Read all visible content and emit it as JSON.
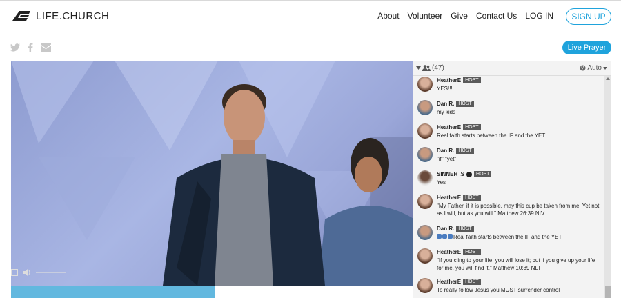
{
  "header": {
    "logo_text": "LIFE.CHURCH",
    "nav": [
      "About",
      "Volunteer",
      "Give",
      "Contact Us",
      "LOG IN"
    ],
    "signup_label": "SIGN UP"
  },
  "share_icons": [
    "twitter-icon",
    "facebook-icon",
    "email-icon"
  ],
  "live_prayer_label": "Live Prayer",
  "chat": {
    "viewer_count": "(47)",
    "quality": "Auto",
    "messages": [
      {
        "name": "HeatherE",
        "badge": "HOST",
        "text": "YES!!!"
      },
      {
        "name": "Dan R.",
        "badge": "HOST",
        "text": "my kids"
      },
      {
        "name": "HeatherE",
        "badge": "HOST",
        "text": "Real faith starts between the IF and the YET."
      },
      {
        "name": "Dan R.",
        "badge": "HOST",
        "text": "\"if\" \"yet\""
      },
      {
        "name": "SINNEH .S",
        "badge": "HOST",
        "text": "Yes"
      },
      {
        "name": "HeatherE",
        "badge": "HOST",
        "text": "\"My Father, if it is possible, may this cup be taken from me. Yet not as I will, but as you will.\" Matthew 26:39 NIV"
      },
      {
        "name": "Dan R.",
        "badge": "HOST",
        "text": "Real faith starts between the IF and the YET."
      },
      {
        "name": "HeatherE",
        "badge": "HOST",
        "text": "\"If you cling to your life, you will lose it; but if you give up your life for me, you will find it.\" Matthew 10:39 NLT"
      },
      {
        "name": "HeatherE",
        "badge": "HOST",
        "text": "To really follow Jesus you MUST surrender control"
      }
    ]
  },
  "colors": {
    "accent": "#1fa3dc",
    "host_badge": "#5a5a5a",
    "chat_bg": "#f3f3f3"
  }
}
